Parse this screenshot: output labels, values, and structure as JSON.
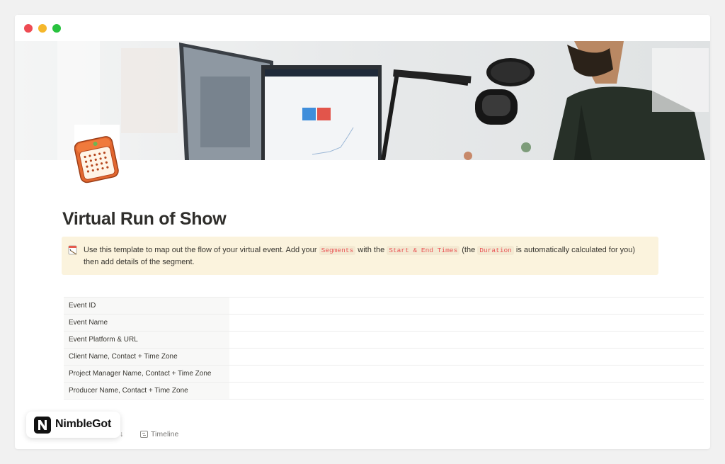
{
  "page": {
    "title": "Virtual Run of Show"
  },
  "callout": {
    "icon": "calendar-pencil-icon",
    "text_1": "Use this template to map out the flow of your virtual event. Add your ",
    "code_segments": "Segments",
    "text_2": " with the ",
    "code_times": "Start & End Times",
    "text_3": " (the ",
    "code_duration": "Duration",
    "text_4": " is automatically calculated for you) then add details of the segment."
  },
  "properties": [
    {
      "label": "Event ID",
      "value": ""
    },
    {
      "label": "Event Name",
      "value": ""
    },
    {
      "label": "Event Platform & URL",
      "value": ""
    },
    {
      "label": "Client Name, Contact + Time Zone",
      "value": ""
    },
    {
      "label": "Project Manager Name, Contact + Time Zone",
      "value": ""
    },
    {
      "label": "Producer Name, Contact + Time Zone",
      "value": ""
    }
  ],
  "views": {
    "partial_label": "s ↓",
    "timeline_label": "Timeline"
  },
  "badge": {
    "logo_letter": "N",
    "text": "NimbleGot"
  },
  "colors": {
    "callout_bg": "#fbf3dd",
    "code_text": "#eb5757",
    "traffic_red": "#ee4b53",
    "traffic_yellow": "#f5b72b",
    "traffic_green": "#29c23f"
  }
}
